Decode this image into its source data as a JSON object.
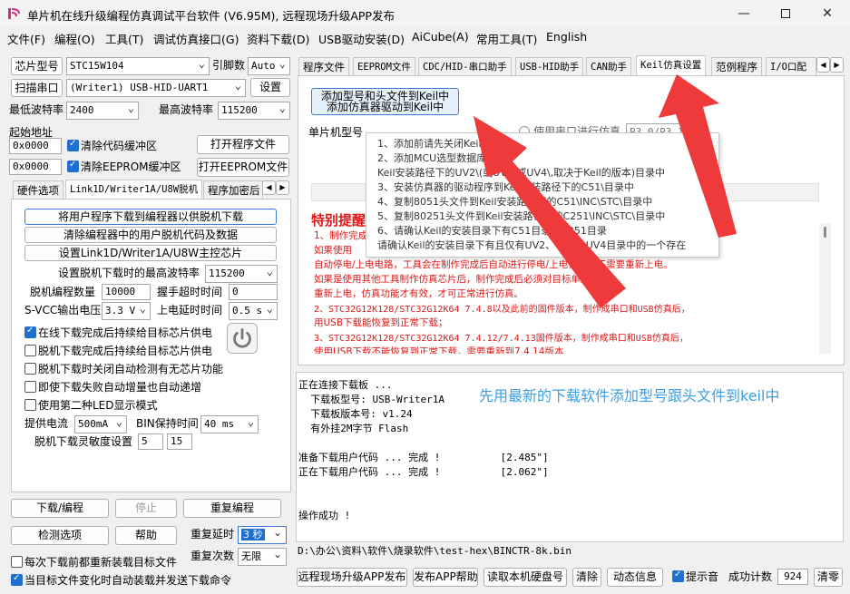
{
  "window": {
    "title": "单片机在线升级编程仿真调试平台软件 (V6.95M), 远程现场升级APP发布"
  },
  "menu": [
    "文件(F)",
    "编程(O)",
    "工具(T)",
    "调试仿真接口(G)",
    "资料下载(D)",
    "USB驱动安装(D)",
    "AiCube(A)",
    "常用工具(T)",
    "English"
  ],
  "left": {
    "chip_label": "芯片型号",
    "chip_value": "STC15W104",
    "pins_label": "引脚数",
    "pins_value": "Auto",
    "scan_label": "扫描串口",
    "port_value": "(Writer1) USB-HID-UART1",
    "settings_label": "设置",
    "min_baud_label": "最低波特率",
    "min_baud_value": "2400",
    "max_baud_label": "最高波特率",
    "max_baud_value": "115200",
    "start_addr_label": "起始地址",
    "addr1": "0x0000",
    "clear_code": "清除代码缓冲区",
    "open_prog": "打开程序文件",
    "addr2": "0x0000",
    "clear_eeprom": "清除EEPROM缓冲区",
    "open_eeprom": "打开EEPROM文件",
    "tabs": [
      "硬件选项",
      "Link1D/Writer1A/U8W脱机",
      "程序加密后"
    ],
    "offline_buttons": [
      "将用户程序下载到编程器以供脱机下载",
      "清除编程器中的用户脱机代码及数据",
      "设置Link1D/Writer1A/U8W主控芯片"
    ],
    "max_baud_offline_label": "设置脱机下载时的最高波特率",
    "max_baud_offline_value": "115200",
    "offline_count_label": "脱机编程数量",
    "offline_count_value": "10000",
    "handshake_label": "握手超时时间",
    "handshake_value": "0",
    "vcc_label": "S-VCC输出电压",
    "vcc_value": "3.3 V",
    "power_delay_label": "上电延时时间",
    "power_delay_value": "0.5 s",
    "options": [
      {
        "label": "在线下载完成后持续给目标芯片供电",
        "checked": true
      },
      {
        "label": "脱机下载完成后持续给目标芯片供电",
        "checked": false
      },
      {
        "label": "脱机下载时关闭自动检测有无芯片功能",
        "checked": false
      },
      {
        "label": "即使下载失败自动增量也自动递增",
        "checked": false
      },
      {
        "label": "使用第二种LED显示模式",
        "checked": false
      }
    ],
    "current_label": "提供电流",
    "current_value": "500mA",
    "bin_label": "BIN保持时间",
    "bin_value": "40 ms",
    "sensitivity_label": "脱机下载灵敏度设置",
    "sens1": "5",
    "sens2": "15",
    "download_btn": "下载/编程",
    "stop_btn": "停止",
    "reprogram_btn": "重复编程",
    "detect_btn": "检测选项",
    "help_btn": "帮助",
    "repeat_delay_label": "重复延时",
    "repeat_delay_value": "3 秒",
    "repeat_count_label": "重复次数",
    "repeat_count_value": "无限",
    "reload_each": "每次下载前都重新装载目标文件",
    "auto_send": "当目标文件变化时自动装载并发送下载命令"
  },
  "right": {
    "tabs": [
      "程序文件",
      "EEPROM文件",
      "CDC/HID-串口助手",
      "USB-HID助手",
      "CAN助手",
      "Keil仿真设置",
      "范例程序",
      "I/O口配"
    ],
    "add_btn_line1": "添加型号和头文件到Keil中",
    "add_btn_line2": "添加仿真器驱动到Keil中",
    "mcu_label": "单片机型号",
    "serial_sim_label": "使用串口进行仿真",
    "serial_value": "P3.0/P3.1",
    "tooltip": [
      "1、添加前请先关闭Keil",
      "2、添加MCU选型数据库到",
      "    Keil安装路径下的UV2\\(或UV3\\或UV4\\,取决于Keil的版本)目录中",
      "3、安装仿真器的驱动程序到Keil安装路径下的C51\\目录中",
      "4、复制8051头文件到Keil安装路径下的C51\\INC\\STC\\目录中",
      "5、复制80251头文件到Keil安装路径下的C251\\INC\\STC\\目录中",
      "6、请确认Keil的安装目录下有C51目录和C251目录",
      "    请确认Keil的安装目录下有且仅有UV2、UV3、UV4目录中的一个存在"
    ],
    "notice_title": "特别提醒",
    "notice_lines": [
      "1、制作完成仿真芯片后",
      "    如果使用",
      "    自动停电/上电电路，工具会在制作完成后自动进行停电/上电，此时不需要重新上电。",
      "    如果是使用其他工具制作仿真芯片后，制作完成后必须对目标单片机",
      "    重新上电，仿真功能才有效，才可正常进行仿真。",
      "2、STC32G12K128/STC32G12K64   7.4.8以及此前的固件版本，制作成串口和USB仿真后，",
      "    用USB下载能恢复到正常下载；",
      "3、STC32G12K128/STC32G12K64   7.4.12/7.4.13固件版本，制作成串口和USB仿真后，",
      "    使用USB下载不能恢复到正常下载，需要重新到7.4.14版本"
    ],
    "log_lines": [
      "正在连接下载板 ...",
      "  下载板型号: USB-Writer1A",
      "  下载板版本号: v1.24",
      "  有外挂2M字节 Flash",
      "",
      "准备下载用户代码 ... 完成 !          [2.485\"]",
      "正在下载用户代码 ... 完成 !          [2.062\"]",
      "",
      "",
      "",
      "操作成功 !"
    ],
    "overlay_text": "先用最新的下载软件添加型号跟头文件到keil中",
    "path": "D:\\办公\\资料\\软件\\烧录软件\\test-hex\\BINCTR-8k.bin",
    "bottom_buttons": [
      "远程现场升级APP发布",
      "发布APP帮助",
      "读取本机硬盘号",
      "清除",
      "动态信息"
    ],
    "beep_label": "提示音",
    "success_label": "成功计数",
    "success_value": "924",
    "clear_count": "清零"
  },
  "colors": {
    "accent": "#1f6fd0",
    "notice_red": "#e01818",
    "arrow_red": "#ee3a3a",
    "overlay_blue": "#3a9ee0"
  }
}
